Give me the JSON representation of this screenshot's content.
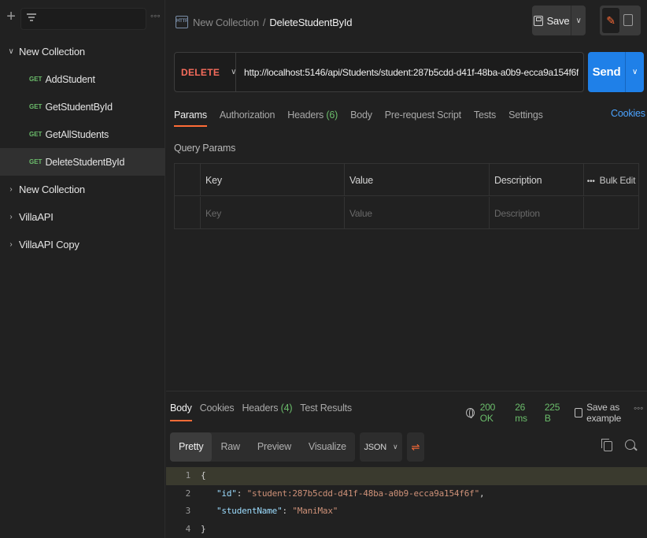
{
  "sidebar": {
    "collections": [
      {
        "label": "New Collection",
        "expanded": true
      },
      {
        "label": "New Collection",
        "expanded": false
      },
      {
        "label": "VillaAPI",
        "expanded": false
      },
      {
        "label": "VillaAPI Copy",
        "expanded": false
      }
    ],
    "requests": [
      {
        "method": "GET",
        "label": "AddStudent"
      },
      {
        "method": "GET",
        "label": "GetStudentById"
      },
      {
        "method": "GET",
        "label": "GetAllStudents"
      },
      {
        "method": "GET",
        "label": "DeleteStudentById",
        "active": true
      }
    ]
  },
  "header": {
    "icon_text": "HTTP",
    "breadcrumb_parent": "New Collection",
    "breadcrumb_sep": "/",
    "breadcrumb_current": "DeleteStudentById",
    "save_label": "Save"
  },
  "request": {
    "method": "DELETE",
    "url": "http://localhost:5146/api/Students/student:287b5cdd-d41f-48ba-a0b9-ecca9a154f6f",
    "send_label": "Send"
  },
  "tabs": {
    "params": "Params",
    "authorization": "Authorization",
    "headers": "Headers",
    "headers_count": "(6)",
    "body": "Body",
    "prerequest": "Pre-request Script",
    "tests": "Tests",
    "settings": "Settings",
    "cookies": "Cookies"
  },
  "query_params": {
    "title": "Query Params",
    "columns": [
      "Key",
      "Value",
      "Description"
    ],
    "bulk_edit": "Bulk Edit",
    "placeholders": [
      "Key",
      "Value",
      "Description"
    ]
  },
  "response": {
    "tabs": {
      "body": "Body",
      "cookies": "Cookies",
      "headers": "Headers",
      "headers_count": "(4)",
      "test_results": "Test Results"
    },
    "status": "200 OK",
    "time": "26 ms",
    "size": "225 B",
    "save_example": "Save as example",
    "formats": [
      "Pretty",
      "Raw",
      "Preview",
      "Visualize"
    ],
    "language": "JSON",
    "code": {
      "open": "{",
      "close": "}",
      "id_key": "\"id\"",
      "id_value": "\"student:287b5cdd-d41f-48ba-a0b9-ecca9a154f6f\"",
      "name_key": "\"studentName\"",
      "name_value": "\"ManiMax\"",
      "line_numbers": [
        "1",
        "2",
        "3",
        "4"
      ]
    }
  },
  "colors": {
    "accent": "#ff6c37",
    "send": "#1f80e8",
    "delete_method": "#f66c5c",
    "get_method": "#6bbd6b",
    "status_ok": "#6bbd6b",
    "link": "#4ba3ff"
  }
}
